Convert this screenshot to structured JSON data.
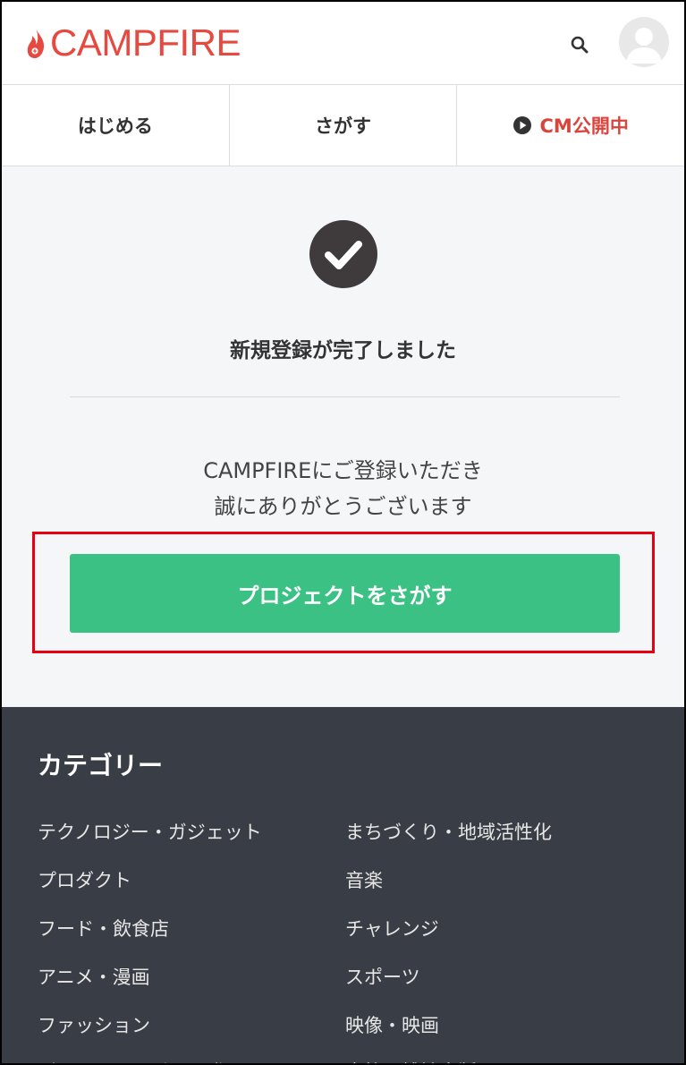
{
  "header": {
    "logo_text": "CAMPFIRE",
    "brand_color": "#e5493f"
  },
  "tabs": [
    {
      "label": "はじめる"
    },
    {
      "label": "さがす"
    },
    {
      "label": "CM公開中",
      "icon": "play-circle-icon",
      "color": "#d9453c"
    }
  ],
  "main": {
    "title": "新規登録が完了しました",
    "message_line1": "CAMPFIREにご登録いただき",
    "message_line2": "誠にありがとうございます",
    "cta_label": "プロジェクトをさがす",
    "cta_color": "#3cc184",
    "highlight_color": "#e60012"
  },
  "footer": {
    "heading": "カテゴリー",
    "categories_left": [
      "テクノロジー・ガジェット",
      "プロダクト",
      "フード・飲食店",
      "アニメ・漫画",
      "ファッション",
      "ゲーム・サービス開発"
    ],
    "categories_right": [
      "まちづくり・地域活性化",
      "音楽",
      "チャレンジ",
      "スポーツ",
      "映像・映画",
      "書籍・雑誌出版"
    ]
  }
}
